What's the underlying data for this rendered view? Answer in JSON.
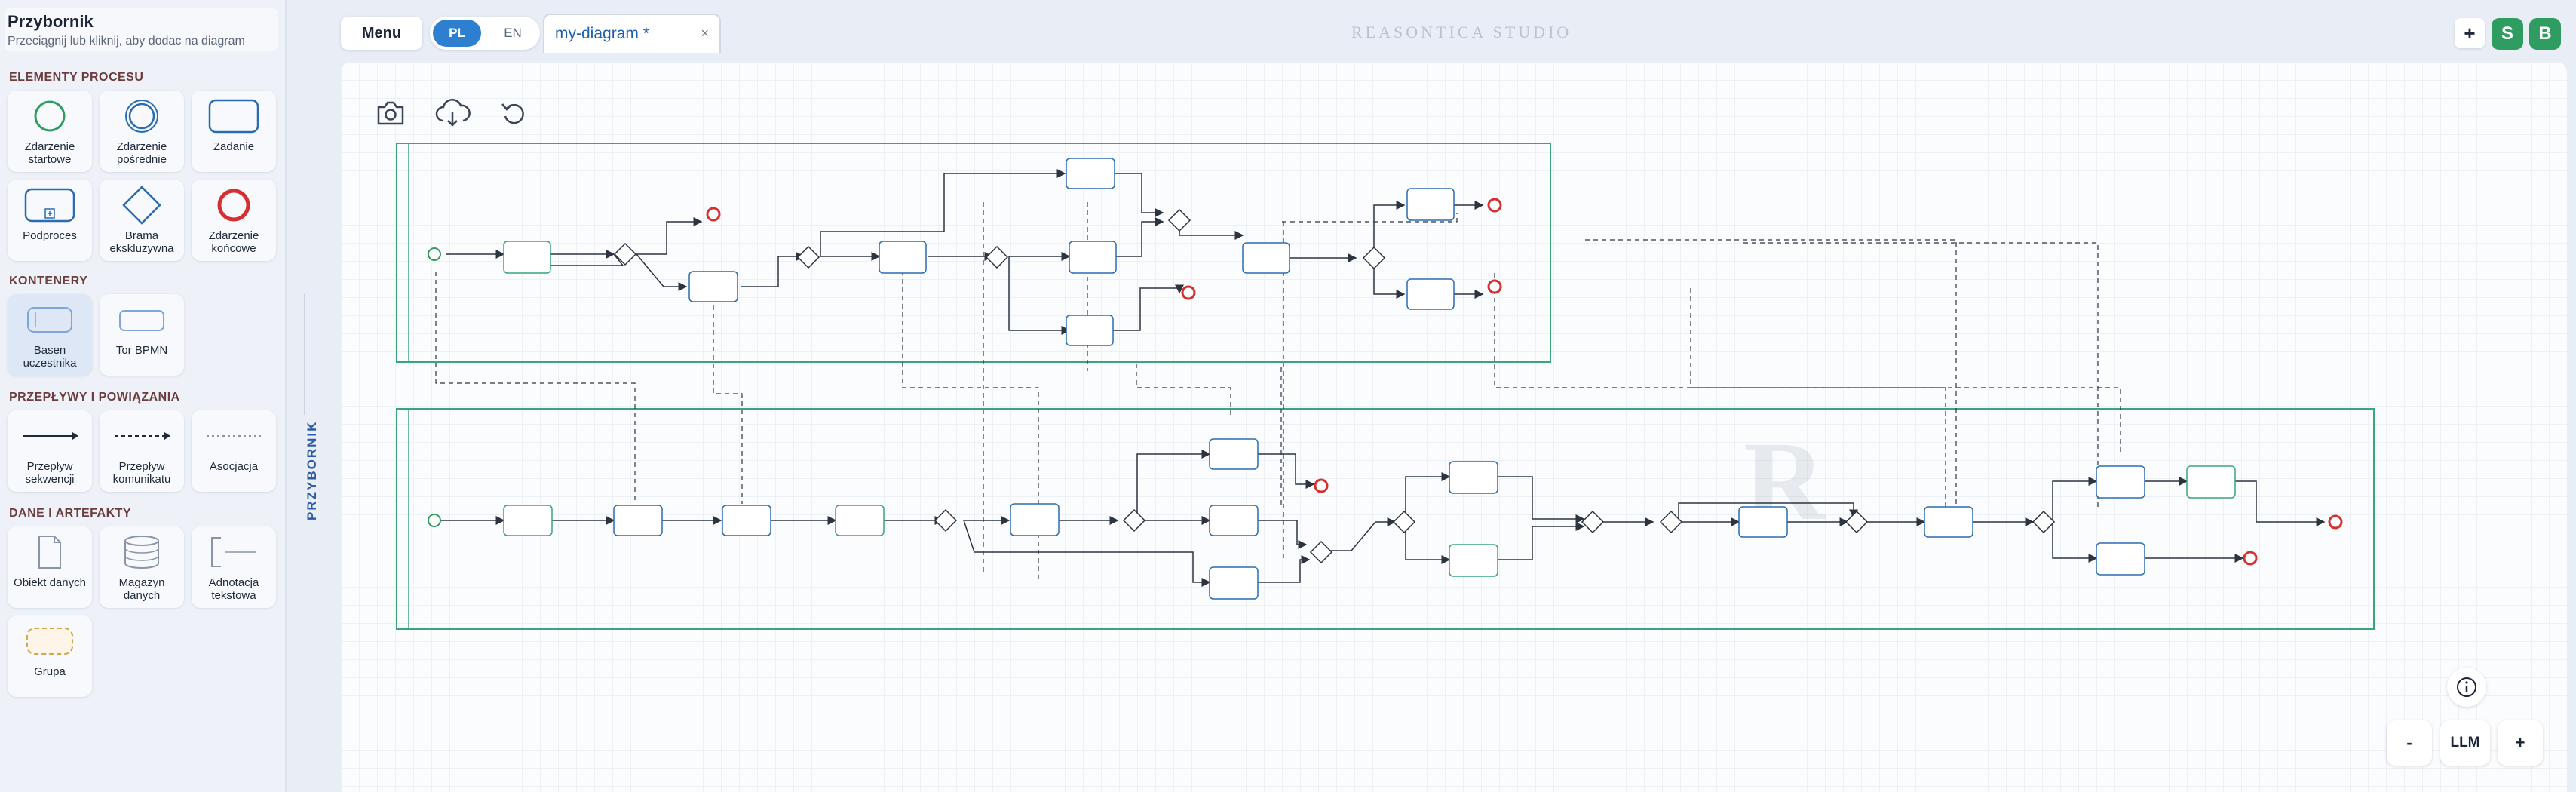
{
  "sidebar": {
    "title": "Przybornik",
    "subtitle": "Przeciągnij lub kliknij, aby dodac na diagram",
    "vertical_tab": "PRZYBORNIK",
    "sections": [
      {
        "label": "ELEMENTY PROCESU",
        "items": [
          {
            "label": "Zdarzenie startowe",
            "icon": "start-event-icon"
          },
          {
            "label": "Zdarzenie pośrednie",
            "icon": "intermediate-event-icon"
          },
          {
            "label": "Zadanie",
            "icon": "task-icon"
          },
          {
            "label": "Podproces",
            "icon": "subprocess-icon"
          },
          {
            "label": "Brama ekskluzywna",
            "icon": "exclusive-gateway-icon"
          },
          {
            "label": "Zdarzenie końcowe",
            "icon": "end-event-icon"
          }
        ]
      },
      {
        "label": "KONTENERY",
        "items": [
          {
            "label": "Basen uczestnika",
            "icon": "pool-icon"
          },
          {
            "label": "Tor BPMN",
            "icon": "lane-icon"
          }
        ]
      },
      {
        "label": "PRZEPŁYWY I POWIĄZANIA",
        "items": [
          {
            "label": "Przepływ sekwencji",
            "icon": "sequence-flow-icon"
          },
          {
            "label": "Przepływ komunikatu",
            "icon": "message-flow-icon"
          },
          {
            "label": "Asocjacja",
            "icon": "association-icon"
          }
        ]
      },
      {
        "label": "DANE I ARTEFAKTY",
        "items": [
          {
            "label": "Obiekt danych",
            "icon": "data-object-icon"
          },
          {
            "label": "Magazyn danych",
            "icon": "data-store-icon"
          },
          {
            "label": "Adnotacja tekstowa",
            "icon": "text-annotation-icon"
          },
          {
            "label": "Grupa",
            "icon": "group-icon"
          }
        ]
      }
    ]
  },
  "topbar": {
    "menu_label": "Menu",
    "lang_pl": "PL",
    "lang_en": "EN",
    "tab_label": "my-diagram *",
    "tab_close": "×",
    "brand": "REASONTICA STUDIO",
    "plus_label": "+",
    "avatar_s": "S",
    "avatar_b": "B"
  },
  "canvas": {
    "icons": [
      "camera-icon",
      "cloud-download-icon",
      "undo-icon"
    ],
    "watermark": "R"
  },
  "controls": {
    "info_icon": "info-icon",
    "zoom_out": "-",
    "llm": "LLM",
    "zoom_in": "+"
  },
  "colors": {
    "accent": "#2f7fd1",
    "avatar_green": "#2f9d62",
    "pool_border": "#3aa57a",
    "task_border": "#2b6cb0",
    "start_event": "#2f9d62",
    "end_event": "#d62f2f"
  }
}
